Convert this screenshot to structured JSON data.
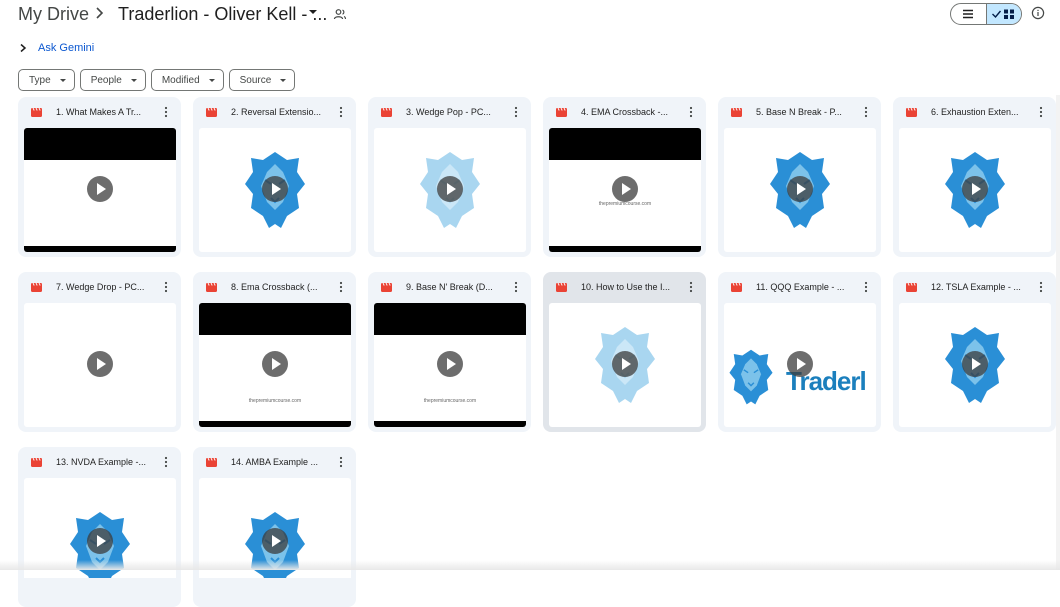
{
  "breadcrumb": {
    "root": "My Drive",
    "folder": "Traderlion - Oliver Kell - ..."
  },
  "gemini": {
    "label": "Ask Gemini"
  },
  "filters": [
    "Type",
    "People",
    "Modified",
    "Source"
  ],
  "colors": {
    "accent": "#0b57d0",
    "video_icon": "#ea4335",
    "card_bg": "#f0f4f9",
    "toggle_active": "#c2e7ff",
    "lion": "#2a8fd6"
  },
  "files": [
    {
      "title": "1. What Makes A Tr...",
      "thumb": "black-bars"
    },
    {
      "title": "2. Reversal Extensio...",
      "thumb": "lion"
    },
    {
      "title": "3. Wedge Pop - PC...",
      "thumb": "lion-faded"
    },
    {
      "title": "4. EMA Crossback -...",
      "thumb": "black-bars-url"
    },
    {
      "title": "5. Base N Break - P...",
      "thumb": "lion"
    },
    {
      "title": "6. Exhaustion Exten...",
      "thumb": "lion"
    },
    {
      "title": "7. Wedge Drop - PC...",
      "thumb": "blank"
    },
    {
      "title": "8. Ema Crossback (...",
      "thumb": "black-bars-url"
    },
    {
      "title": "9. Base N' Break (D...",
      "thumb": "black-bars-url"
    },
    {
      "title": "10. How to Use the I...",
      "thumb": "lion-faded",
      "selected": true
    },
    {
      "title": "11. QQQ Example - ...",
      "thumb": "brand",
      "brand_text": "Traderl"
    },
    {
      "title": "12. TSLA Example - ...",
      "thumb": "lion"
    },
    {
      "title": "13. NVDA Example -...",
      "thumb": "lion"
    },
    {
      "title": "14. AMBA Example ...",
      "thumb": "lion"
    }
  ],
  "watermark_url": "thepremiumcourse.com"
}
